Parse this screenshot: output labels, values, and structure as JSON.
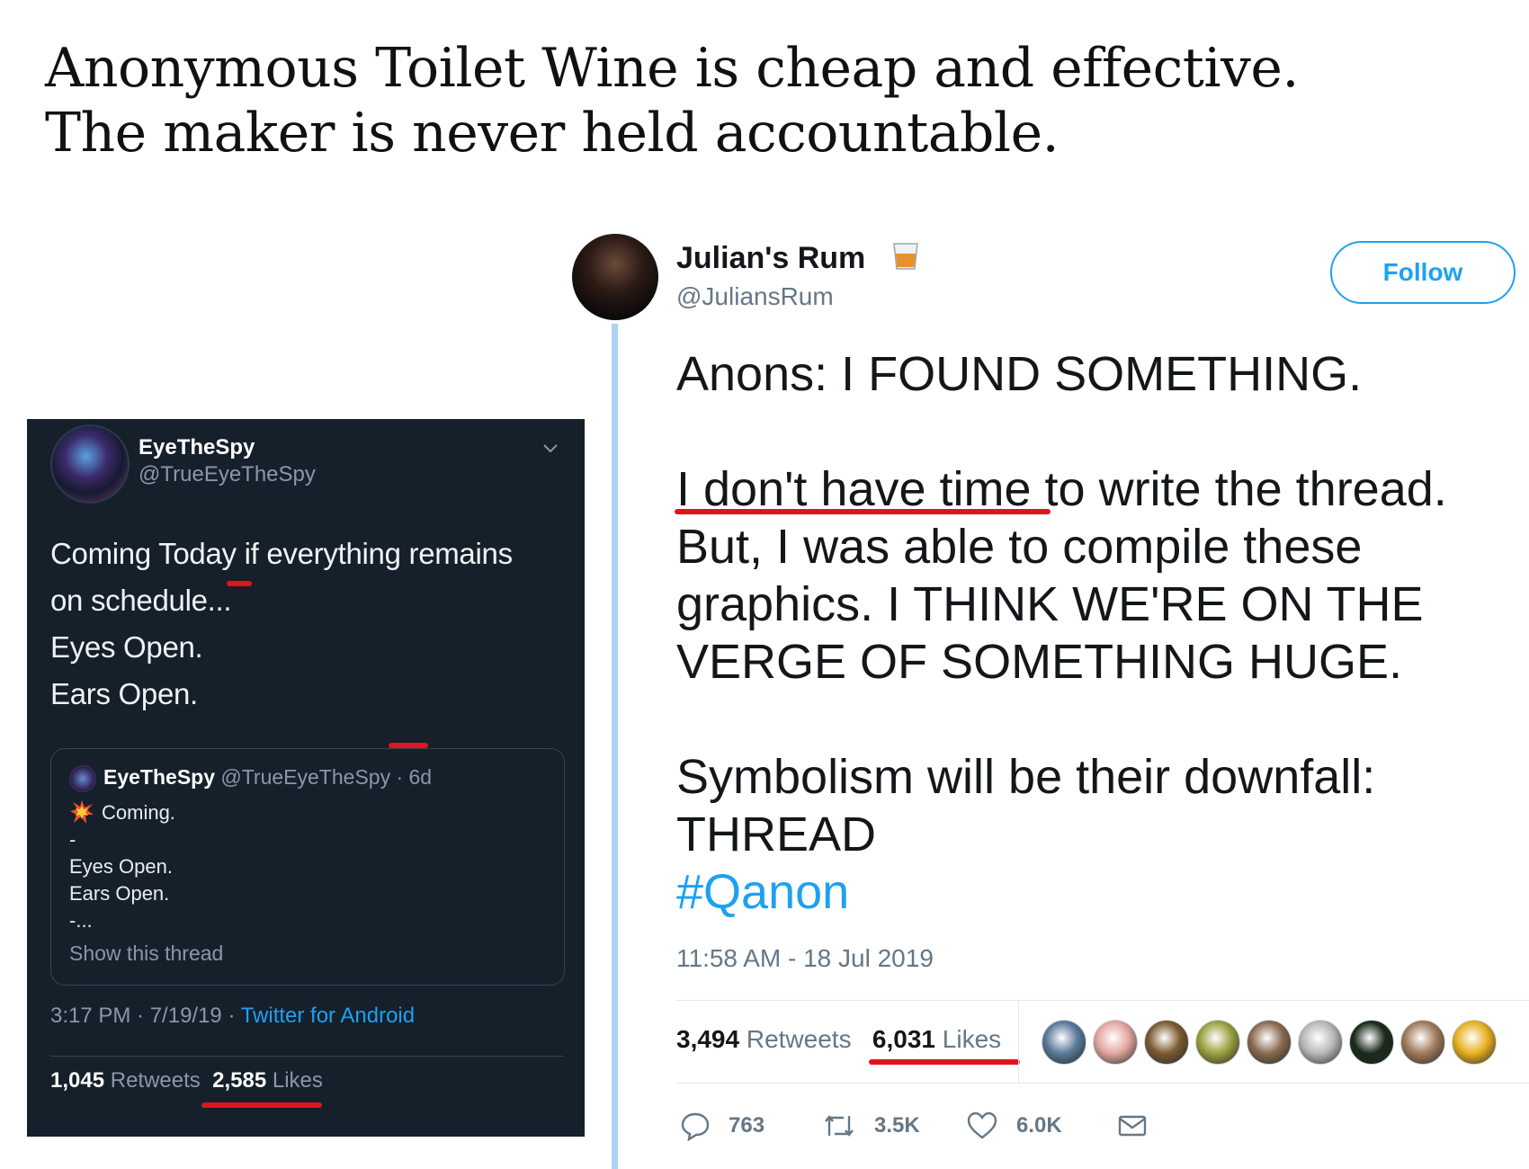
{
  "headline": {
    "line1": "Anonymous Toilet Wine is cheap and effective.",
    "line2": "The maker is never held accountable."
  },
  "left_tweet": {
    "name": "EyeTheSpy",
    "handle": "@TrueEyeTheSpy",
    "body": [
      "Coming Today if everything remains",
      "on schedule...",
      "Eyes Open.",
      "Ears Open."
    ],
    "quote": {
      "name": "EyeTheSpy",
      "meta": "@TrueEyeTheSpy · 6d",
      "lines": [
        "Coming.",
        "-",
        "Eyes Open.",
        "Ears Open.",
        "-..."
      ],
      "show_thread": "Show this thread"
    },
    "timestamp": "3:17 PM · 7/19/19 · ",
    "source": "Twitter for Android",
    "retweets": "1,045",
    "retweets_label": "Retweets",
    "likes": "2,585",
    "likes_label": "Likes",
    "icons": {
      "spark": "collision-emoji",
      "menu": "chevron-down-icon"
    }
  },
  "right_tweet": {
    "name": "Julian's Rum",
    "handle": "@JuliansRum",
    "follow_label": "Follow",
    "body": {
      "line1": "Anons: I FOUND SOMETHING.",
      "line2": "I don't have time to write the thread.",
      "line3": "But, I was able to compile these",
      "line4": "graphics. I THINK WE'RE ON THE",
      "line5": "VERGE OF SOMETHING HUGE.",
      "line6": "Symbolism will be their downfall:",
      "line7": "THREAD",
      "hashtag": "#Qanon"
    },
    "timestamp": "11:58 AM - 18 Jul 2019",
    "retweets": "3,494",
    "retweets_label": "Retweets",
    "likes": "6,031",
    "likes_label": "Likes",
    "actions": {
      "replies": "763",
      "retweets": "3.5K",
      "likes": "6.0K"
    },
    "liker_colors": [
      "#5a7a9a",
      "#e4a6a0",
      "#7a5a30",
      "#9aa040",
      "#8a6a50",
      "#b8b8b8",
      "#1a2a1a",
      "#a07a5a",
      "#e8b020"
    ],
    "colors": {
      "accent": "#1da1f2",
      "thread_line": "#a8d5f2",
      "highlight": "#e0141e"
    }
  }
}
